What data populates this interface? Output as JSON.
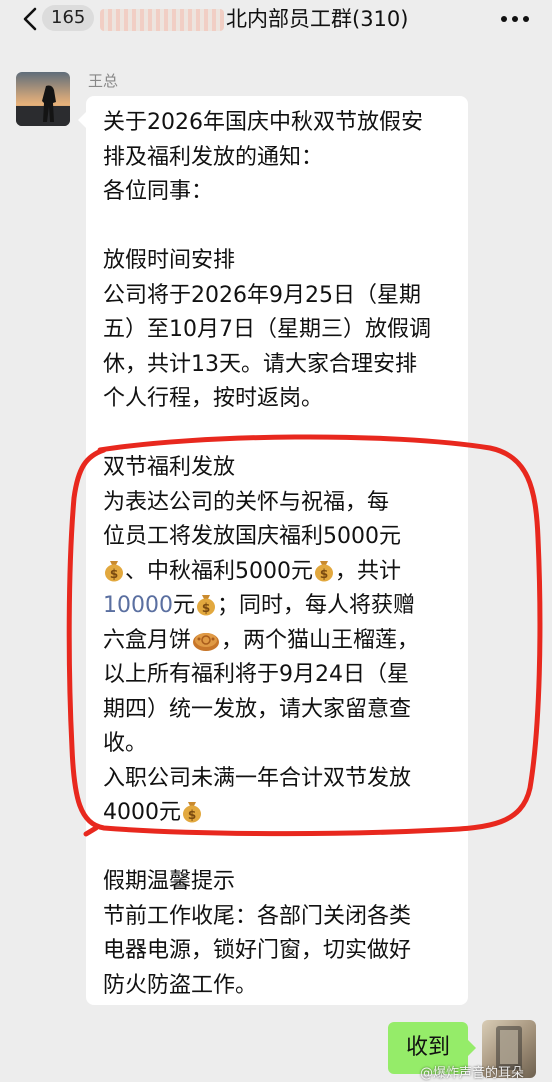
{
  "header": {
    "unread_count": "165",
    "title": "北内部员工群(310)"
  },
  "sender": {
    "name": "王总"
  },
  "message": {
    "lines": [
      "关于2026年国庆中秋双节放假安",
      "排及福利发放的通知：",
      "各位同事：",
      "",
      "放假时间安排",
      "公司将于2026年9月25日（星期",
      "五）至10月7日（星期三）放假调",
      "休，共计13天。请大家合理安排",
      "个人行程，按时返岗。",
      "",
      "双节福利发放",
      "为表达公司的关怀与祝福，每",
      "位员工将发放国庆福利5000元",
      "、中秋福利5000元",
      "，共计",
      "10000",
      "元",
      "；同时，每人将获赠",
      "六盒月饼",
      "，两个猫山王榴莲，",
      "以上所有福利将于9月24日（星",
      "期四）统一发放，请大家留意查",
      "收。",
      "入职公司未满一年合计双节发放",
      "4000元",
      "",
      "假期温馨提示",
      "节前工作收尾：各部门关闭各类",
      "电器电源，锁好门窗，切实做好",
      "防火防盗工作。"
    ]
  },
  "reply": {
    "text": "收到"
  },
  "watermark": "@爆炸声音的耳朵",
  "colors": {
    "background": "#ededed",
    "bubble_received": "#ffffff",
    "bubble_sent": "#95ec69",
    "annotation_red": "#e8281e",
    "link_number": "#5a6fa0"
  },
  "icons": [
    "back-chevron-icon",
    "more-dots-icon",
    "money-bag-icon",
    "mooncake-icon"
  ]
}
